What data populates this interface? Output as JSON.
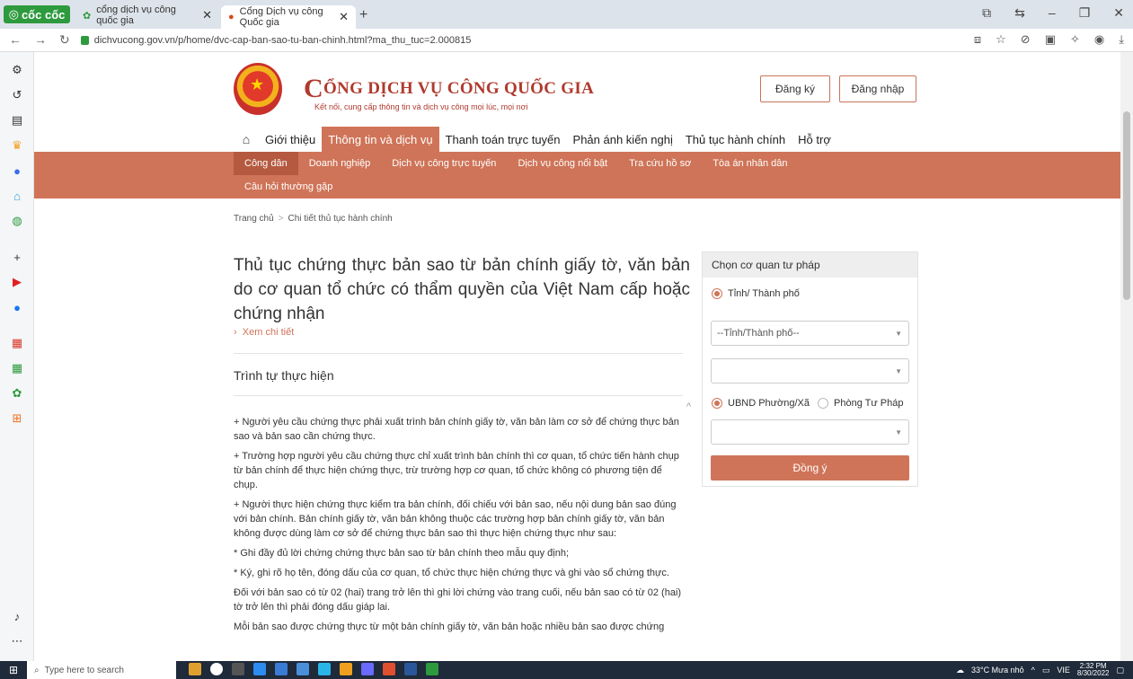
{
  "browser": {
    "brand": "cốc cốc",
    "tabs": [
      {
        "title": "cổng dịch vụ công quốc gia"
      },
      {
        "title": "Cổng Dịch vụ công Quốc gia"
      }
    ],
    "url": "dichvucong.gov.vn/p/home/dvc-cap-ban-sao-tu-ban-chinh.html?ma_thu_tuc=2.000815"
  },
  "site": {
    "title": "CỔNG DỊCH VỤ CÔNG QUỐC GIA",
    "title_initial": "C",
    "title_rest": "ỔNG DỊCH VỤ CÔNG QUỐC GIA",
    "subtitle": "Kết nối, cung cấp thông tin và dịch vụ công mọi lúc, mọi nơi",
    "register": "Đăng ký",
    "login": "Đăng nhập"
  },
  "main_nav": [
    "Giới thiệu",
    "Thông tin và dịch vụ",
    "Thanh toán trực tuyến",
    "Phản ánh kiến nghị",
    "Thủ tục hành chính",
    "Hỗ trợ"
  ],
  "sub_nav": {
    "row1": [
      "Công dân",
      "Doanh nghiệp",
      "Dịch vụ công trực tuyến",
      "Dịch vụ công nổi bật",
      "Tra cứu hồ sơ",
      "Tòa án nhân dân"
    ],
    "row2": [
      "Câu hỏi thường gặp"
    ]
  },
  "breadcrumb": {
    "home": "Trang chủ",
    "current": "Chi tiết thủ tục hành chính"
  },
  "procedure": {
    "title": "Thủ tục chứng thực bản sao từ bản chính giấy tờ, văn bản do cơ quan tổ chức có thẩm quyền của Việt Nam cấp hoặc chứng nhận",
    "more": "Xem chi tiết",
    "section": "Trình tự thực hiện",
    "paragraphs": [
      "+ Người yêu cầu chứng thực phải xuất trình bản chính giấy tờ, văn bản làm cơ sở để chứng thực bản sao và bản sao cần chứng thực.",
      "+ Trường hợp người yêu cầu chứng thực chỉ xuất trình bản chính thì cơ quan, tổ chức tiến hành chụp từ bản chính để thực hiện chứng thực, trừ trường hợp cơ quan, tổ chức không có phương tiện để chụp.",
      "+ Người thực hiện chứng thực kiểm tra bản chính, đối chiếu với bản sao, nếu nội dung bản sao đúng với bản chính. Bản chính giấy tờ, văn bản không thuộc các trường hợp bản chính giấy tờ, văn bản không được dùng làm cơ sở để chứng thực bản sao thì thực hiện chứng thực như sau:",
      "* Ghi đầy đủ lời chứng chứng thực bản sao từ bản chính theo mẫu quy định;",
      "* Ký, ghi rõ họ tên, đóng dấu của cơ quan, tổ chức thực hiện chứng thực và ghi vào sổ chứng thực.",
      "Đối với bản sao có từ 02 (hai) trang trở lên thì ghi lời chứng vào trang cuối, nếu bản sao có từ 02 (hai) tờ trở lên thì phải đóng dấu giáp lai.",
      "Mỗi bản sao được chứng thực từ một bản chính giấy tờ, văn bản hoặc nhiều bản sao được chứng"
    ]
  },
  "panel": {
    "heading": "Chọn cơ quan tư pháp",
    "radio_province": "Tỉnh/ Thành phố",
    "select_province": "--Tỉnh/Thành phố--",
    "radio_ward": "UBND Phường/Xã",
    "radio_justice": "Phòng Tư Pháp",
    "submit": "Đồng ý"
  },
  "taskbar": {
    "search_placeholder": "Type here to search",
    "weather": "33°C Mưa nhỏ",
    "lang": "VIE",
    "time": "2:32 PM",
    "date": "8/30/2022"
  }
}
